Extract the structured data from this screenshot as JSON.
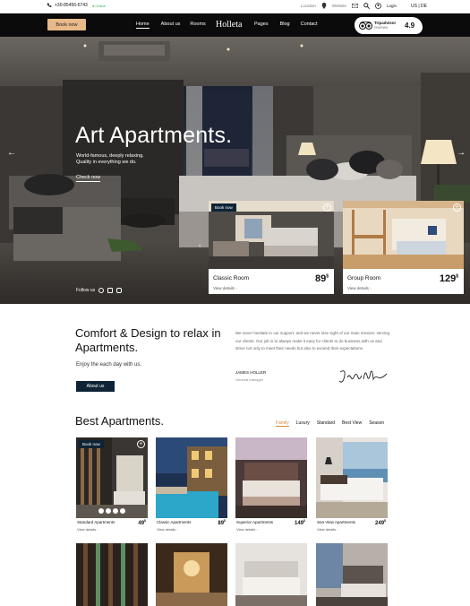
{
  "topbar": {
    "phone": "+30-85456-6743",
    "online": "● Online",
    "location": "Location",
    "website": "Website",
    "login": "Login",
    "lang": "US | DE"
  },
  "nav": {
    "book_now": "Book now",
    "items_left": [
      "Home",
      "About us",
      "Rooms"
    ],
    "brand": "Holleta",
    "items_right": [
      "Pages",
      "Blog",
      "Contact"
    ],
    "tripadvisor": {
      "name": "Tripadvisor",
      "sub": "reviews",
      "rating": "4.9"
    }
  },
  "hero": {
    "title": "Art Apartments.",
    "subtitle": "World-famous, deeply relaxing. Quality in everything we do.",
    "check_now": "Check now",
    "follow": "Follow us",
    "cards": [
      {
        "tag": "Book now",
        "name": "Classic Room",
        "price": "89",
        "currency": "$",
        "link": "View details"
      },
      {
        "name": "Group Room",
        "price": "129",
        "currency": "$",
        "link": "View details"
      }
    ]
  },
  "comfort": {
    "heading": "Comfort & Design to relax in Apartments.",
    "enjoy": "Enjoy the each day with us.",
    "about_button": "About us",
    "paragraph": "We never hesitate in our support, and we never lose sight of our main mission: serving our clients. Our job is to always make it easy for clients to do business with us and strive not only to meet their needs but also to exceed their expectations.",
    "name": "JAMES HOLLER",
    "role": "General manager",
    "signature": "James Holler"
  },
  "best": {
    "heading": "Best Apartments.",
    "filters": [
      "Family",
      "Luxury",
      "Standard",
      "Best View",
      "Season"
    ],
    "apartments": [
      {
        "tag": "Book now",
        "name": "Standard Apartments",
        "price": "49",
        "currency": "$",
        "link": "View details"
      },
      {
        "name": "Classic Apartments",
        "price": "89",
        "currency": "$",
        "link": "View details"
      },
      {
        "name": "Superior Apartments",
        "price": "149",
        "currency": "$",
        "link": "View details"
      },
      {
        "name": "Sea View Apartments",
        "price": "249",
        "currency": "$",
        "link": "View details"
      }
    ]
  }
}
